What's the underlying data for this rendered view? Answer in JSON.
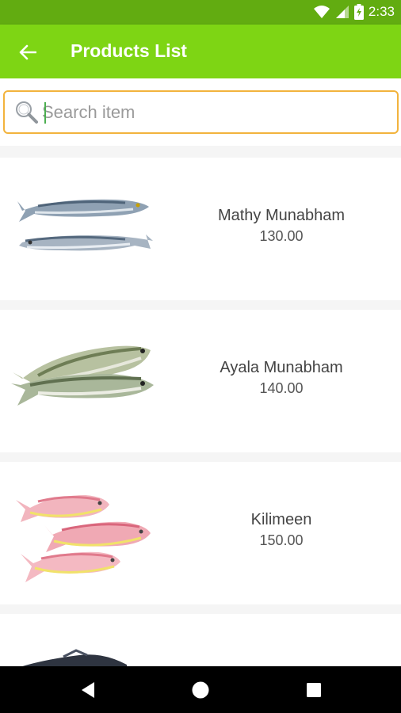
{
  "status_bar": {
    "time": "2:33"
  },
  "app_bar": {
    "title": "Products List"
  },
  "search": {
    "placeholder": "Search item",
    "value": ""
  },
  "products": [
    {
      "name": "Mathy Munabham",
      "price": "130.00"
    },
    {
      "name": "Ayala Munabham",
      "price": "140.00"
    },
    {
      "name": "Kilimeen",
      "price": "150.00"
    }
  ],
  "colors": {
    "status_bar": "#62ac11",
    "app_bar": "#7ed514",
    "search_border": "#f2b33d"
  }
}
